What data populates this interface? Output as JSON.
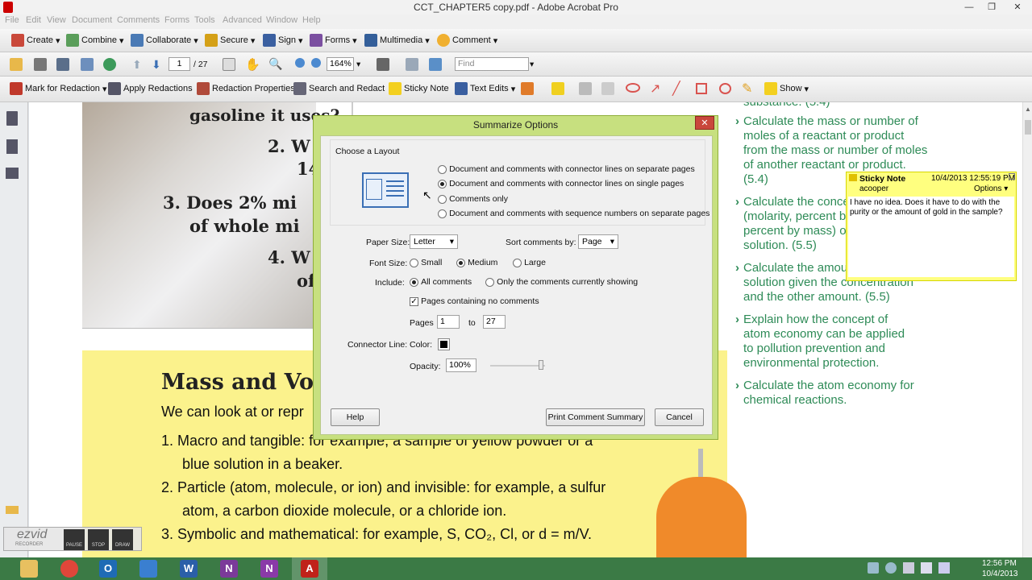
{
  "window": {
    "title": "CCT_CHAPTER5 copy.pdf - Adobe Acrobat Pro",
    "minimize": "—",
    "restore": "❐",
    "close": "✕"
  },
  "menu": [
    "File",
    "Edit",
    "View",
    "Document",
    "Comments",
    "Forms",
    "Tools",
    "Advanced",
    "Window",
    "Help"
  ],
  "toolbar1": {
    "create": "Create",
    "combine": "Combine",
    "collaborate": "Collaborate",
    "secure": "Secure",
    "sign": "Sign",
    "forms": "Forms",
    "multimedia": "Multimedia",
    "comment": "Comment"
  },
  "toolbar2": {
    "page_current": "1",
    "page_total": "/ 27",
    "zoom": "164%",
    "find_placeholder": "Find"
  },
  "toolbar3": {
    "mark_redaction": "Mark for Redaction",
    "apply_redactions": "Apply Redactions",
    "redaction_properties": "Redaction Properties",
    "search_redact": "Search and Redact",
    "sticky_note": "Sticky Note",
    "text_edits": "Text Edits",
    "show": "Show"
  },
  "document": {
    "partial_top": "gasoline it uses?",
    "q2a": "2. W",
    "q2b": "14",
    "q3a": "3. Does 2% mi",
    "q3b": "of whole mi",
    "q4a": "4. W",
    "q4b": "of",
    "heading": "Mass and Volu",
    "intro": "We can look at or repr",
    "item1a": "1.  Macro and tangible: for example, a sample of yellow powder or a",
    "item1b": "blue solution in a beaker.",
    "item2a": "2.  Particle (atom, molecule, or ion) and invisible: for example, a sulfur",
    "item2b": "atom, a carbon dioxide molecule, or a chloride ion.",
    "item3": "3.  Symbolic and mathematical: for example, S, CO₂, Cl, or d = m/V.",
    "right_top": "substance. (5.4)",
    "obj1": [
      "Calculate the mass or number of",
      "moles of a reactant or product",
      "from the mass or number of moles",
      "of another reactant or product.",
      "(5.4)"
    ],
    "obj2": [
      "Calculate the conce",
      "(molarity, percent b",
      "percent by mass) o",
      "solution. (5.5)"
    ],
    "obj3": [
      "Calculate the amou",
      "solution given the concentration",
      "and the other amount. (5.5)"
    ],
    "obj4": [
      "Explain how the concept of",
      "atom economy can be applied",
      "to pollution prevention and",
      "environmental protection."
    ],
    "obj5": [
      "Calculate the atom economy for",
      "chemical reactions."
    ]
  },
  "sticky": {
    "title": "Sticky Note",
    "date": "10/4/2013 12:55:19 PM",
    "author": "acooper",
    "options": "Options ▾",
    "body": "I have no idea. Does it have to do with the purity or the amount of gold in the sample?"
  },
  "dialog": {
    "title": "Summarize Options",
    "close": "✕",
    "layout_group": "Choose a Layout",
    "layout_options": [
      "Document and comments with connector lines on separate pages",
      "Document and comments with connector lines on single pages",
      "Comments only",
      "Document and comments with sequence numbers on separate pages"
    ],
    "layout_selected": 1,
    "paper_size_label": "Paper Size:",
    "paper_size": "Letter",
    "sort_label": "Sort comments by:",
    "sort_value": "Page",
    "font_size_label": "Font Size:",
    "font_small": "Small",
    "font_medium": "Medium",
    "font_large": "Large",
    "include_label": "Include:",
    "include_all": "All comments",
    "include_showing": "Only the comments currently showing",
    "pages_no_comments": "Pages containing no comments",
    "pages_label": "Pages",
    "page_from": "1",
    "to_label": "to",
    "page_to": "27",
    "connector_label": "Connector Line:",
    "color_label": "Color:",
    "connector_color": "#000000",
    "opacity_label": "Opacity:",
    "opacity_value": "100%",
    "help": "Help",
    "print": "Print Comment Summary",
    "cancel": "Cancel"
  },
  "recorder": {
    "brand": "ezvid",
    "sub": "RECORDER",
    "pause": "PAUSE",
    "stop": "STOP",
    "draw": "DRAW"
  },
  "taskbar": {
    "time": "12:56 PM",
    "date": "10/4/2013"
  }
}
